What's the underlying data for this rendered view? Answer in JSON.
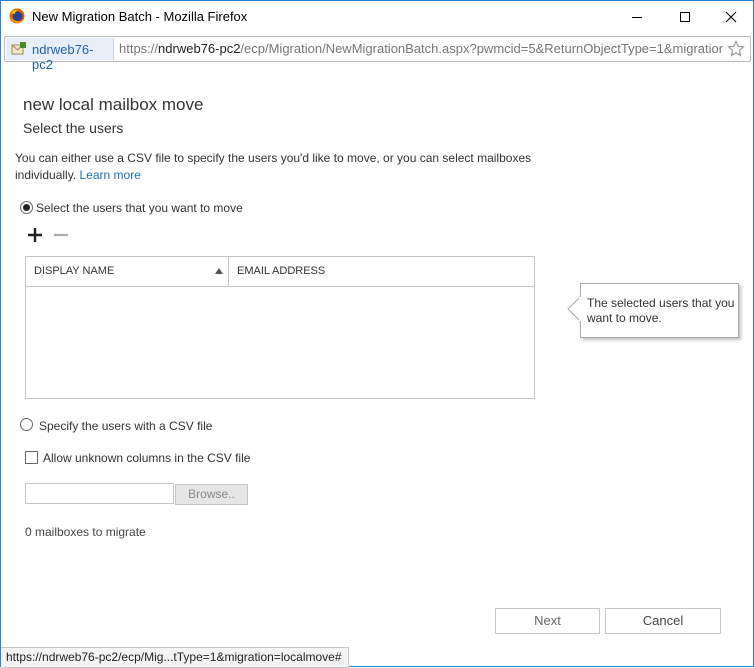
{
  "window": {
    "title": "New Migration Batch - Mozilla Firefox",
    "accent": "#2d7fd0"
  },
  "urlbar": {
    "site_name": "ndrweb76-pc2",
    "url_prefix": "https://",
    "url_host": "ndrweb76-pc2",
    "url_path": "/ecp/Migration/NewMigrationBatch.aspx?pwmcid=5&ReturnObjectType=1&migration=loc"
  },
  "page": {
    "title": "new local mailbox move",
    "subtitle": "Select the users",
    "description": "You can either use a CSV file to specify the users you'd like to move, or you can select mailboxes individually.",
    "learn_more": "Learn more",
    "option_select_users": "Select the users that you want to move",
    "option_select_users_checked": true,
    "grid": {
      "columns": [
        "DISPLAY NAME",
        "EMAIL ADDRESS"
      ],
      "rows": []
    },
    "callout": "The selected users that you want to move.",
    "option_csv": "Specify the users with a CSV file",
    "option_csv_checked": false,
    "allow_unknown_columns": "Allow unknown columns in the CSV file",
    "allow_unknown_checked": false,
    "file_value": "",
    "browse_label": "Browse..",
    "mailbox_count": "0 mailboxes to migrate",
    "next_label": "Next",
    "cancel_label": "Cancel",
    "link_color": "#1e6fb6"
  },
  "statusbar": {
    "text": "https://ndrweb76-pc2/ecp/Mig...tType=1&migration=localmove#"
  }
}
